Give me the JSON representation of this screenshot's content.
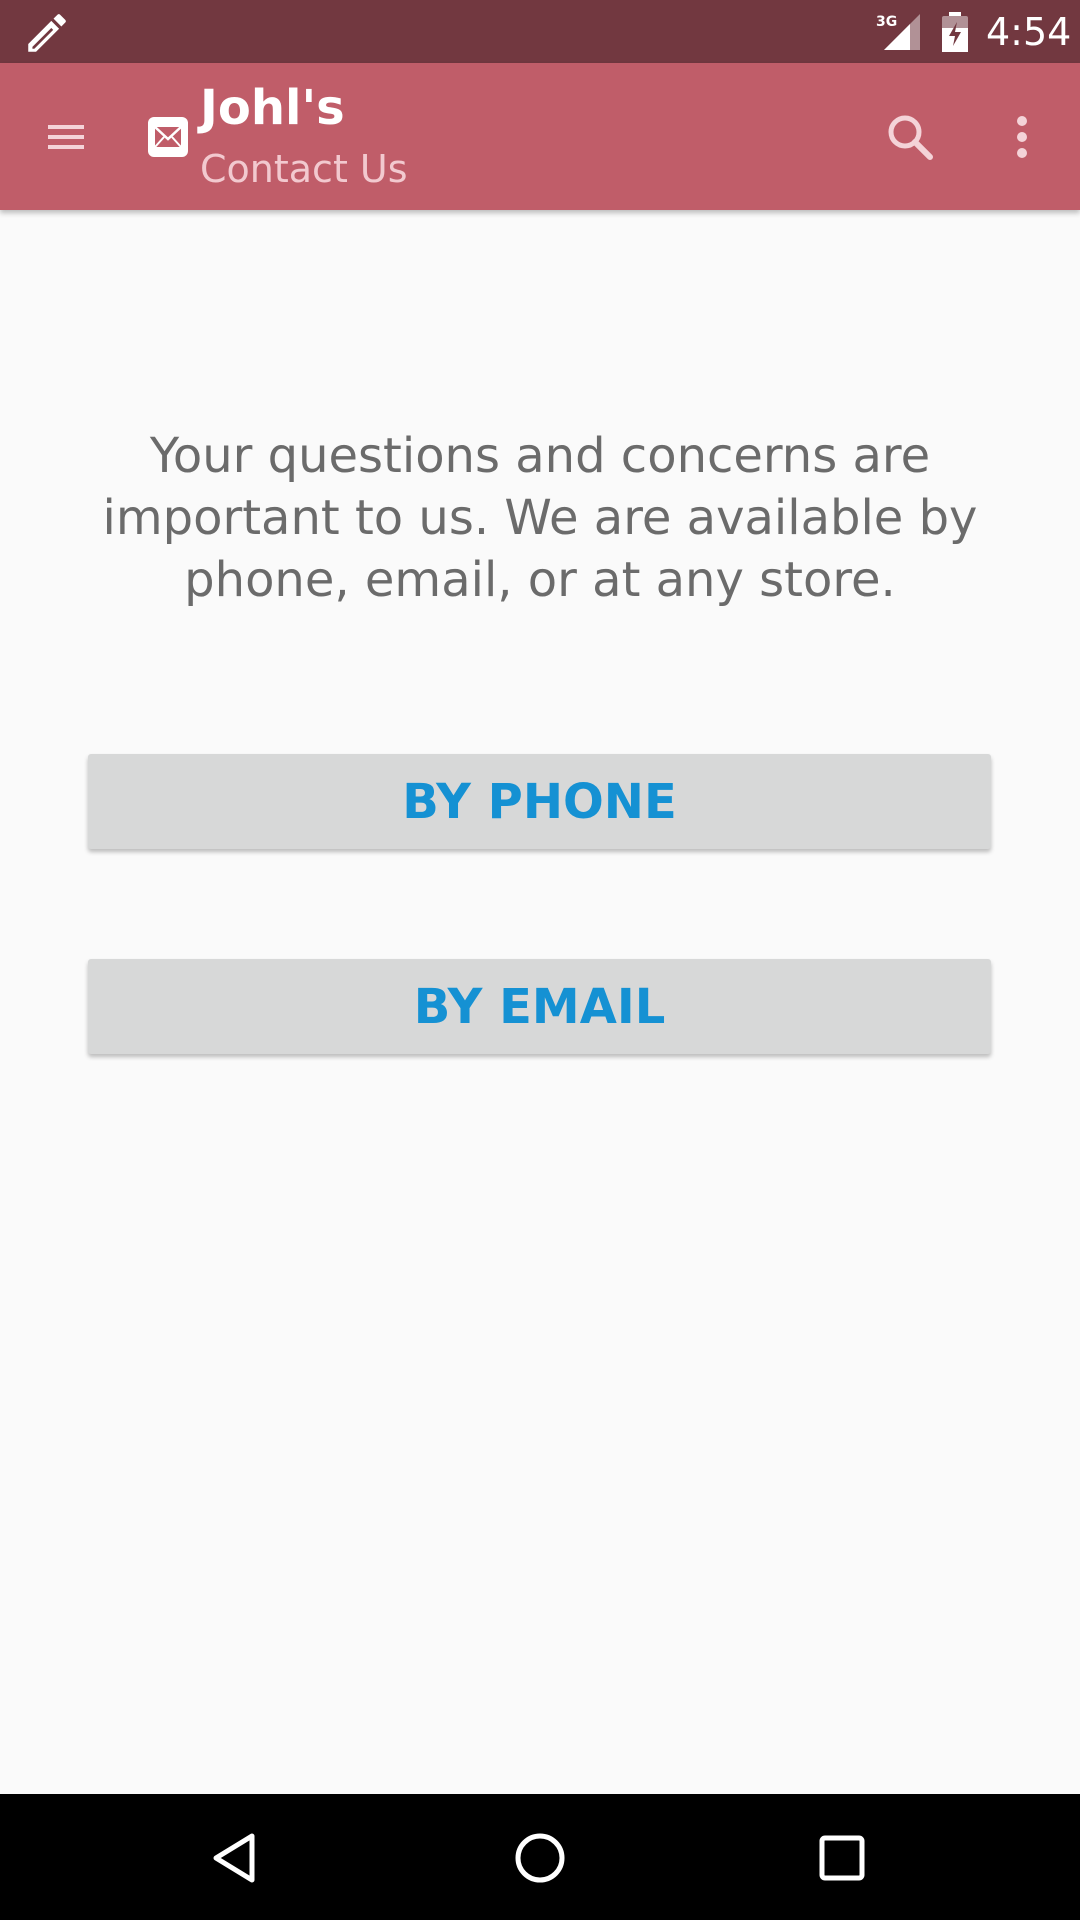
{
  "status_bar": {
    "network_label": "3G",
    "time": "4:54"
  },
  "app_bar": {
    "title": "Johl's",
    "subtitle": "Contact Us",
    "icons": {
      "menu": "menu-icon",
      "app": "email-icon",
      "search": "search-icon",
      "overflow": "more-vert-icon"
    }
  },
  "content": {
    "intro": "Your questions and concerns are important to us. We are available by phone, email, or at any store.",
    "phone_button": "BY PHONE",
    "email_button": "BY EMAIL"
  },
  "colors": {
    "status_bar": "#723840",
    "app_bar": "#c05d69",
    "button_text": "#1591d3",
    "button_bg": "#d7d8d8"
  }
}
